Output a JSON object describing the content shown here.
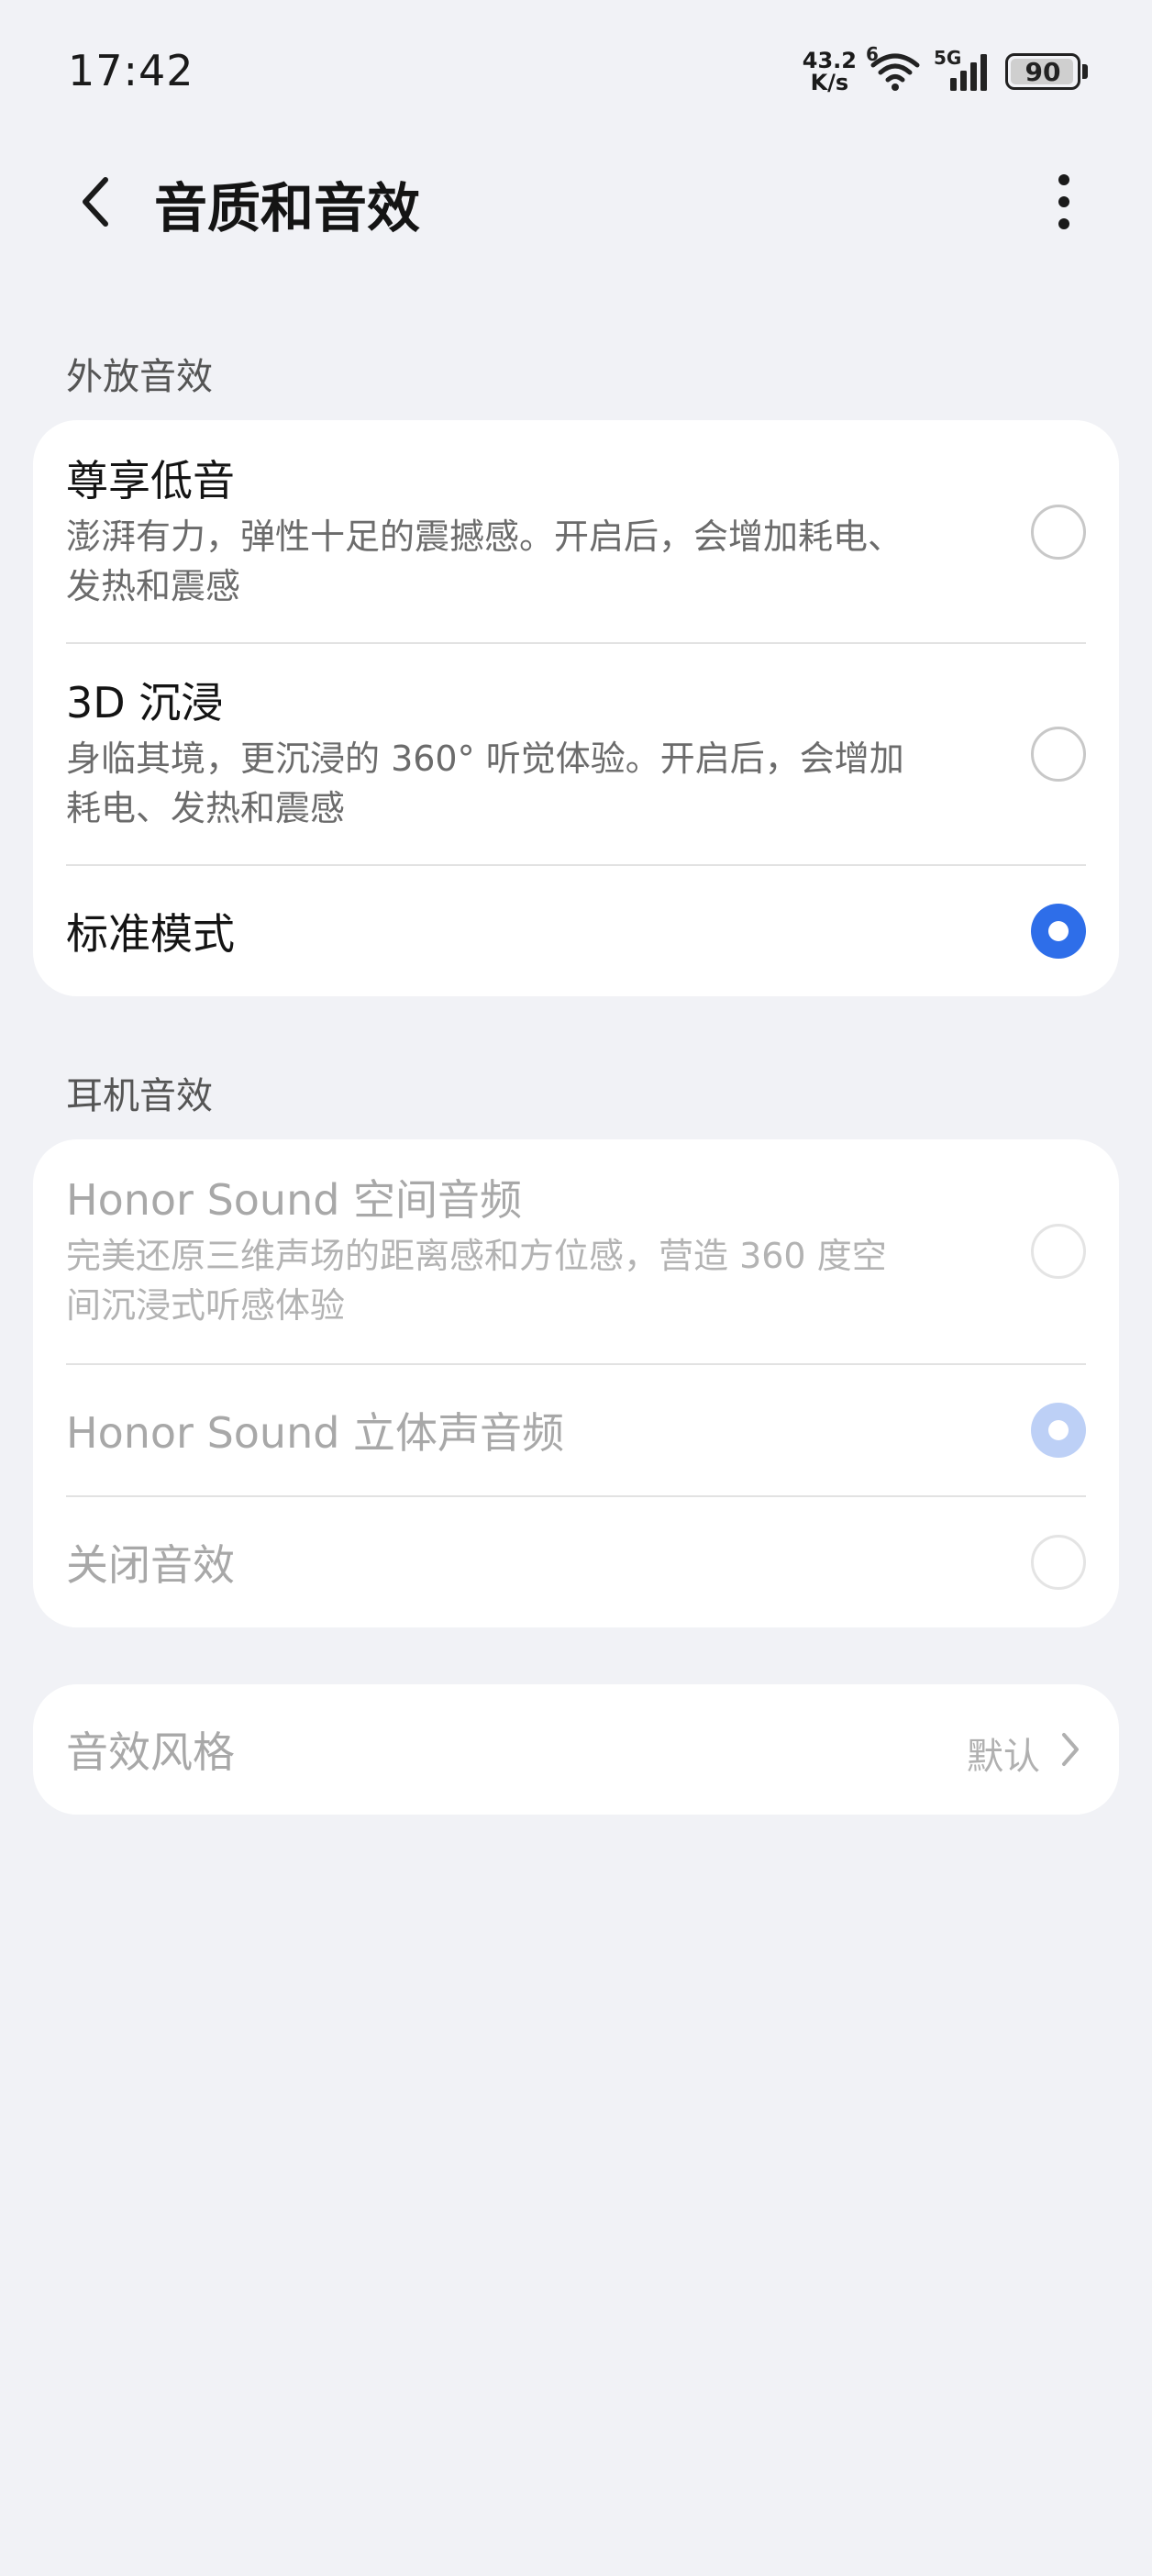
{
  "status_bar": {
    "time": "17:42",
    "net_speed_value": "43.2",
    "net_speed_unit": "K/s",
    "wifi_badge": "6",
    "cell_badge": "5G",
    "battery": "90",
    "icons": [
      "wifi-icon",
      "signal-icon",
      "battery-icon"
    ]
  },
  "header": {
    "title": "音质和音效",
    "back_icon": "chevron-left-icon",
    "more_icon": "more-vertical-icon"
  },
  "speaker_section": {
    "label": "外放音效",
    "options": [
      {
        "title": "尊享低音",
        "desc_line1": "澎湃有力，弹性十足的震撼感。开启后，会增加耗电、",
        "desc_line2": "发热和震感",
        "selected": false
      },
      {
        "title": "3D 沉浸",
        "desc_line1": "身临其境，更沉浸的 360° 听觉体验。开启后，会增加",
        "desc_line2": "耗电、发热和震感",
        "selected": false
      },
      {
        "title": "标准模式",
        "selected": true
      }
    ]
  },
  "headphone_section": {
    "label": "耳机音效",
    "disabled": true,
    "options": [
      {
        "title": "Honor Sound 空间音频",
        "desc_line1": "完美还原三维声场的距离感和方位感，营造 360 度空",
        "desc_line2": "间沉浸式听感体验",
        "selected": false
      },
      {
        "title": "Honor Sound 立体声音频",
        "selected": true
      },
      {
        "title": "关闭音效",
        "selected": false
      }
    ]
  },
  "style_row": {
    "label": "音效风格",
    "value": "默认",
    "icon": "chevron-right-icon"
  },
  "colors": {
    "background": "#f1f2f6",
    "card": "#ffffff",
    "accent": "#2e6ee9",
    "accent_disabled": "#bdd0f6"
  }
}
